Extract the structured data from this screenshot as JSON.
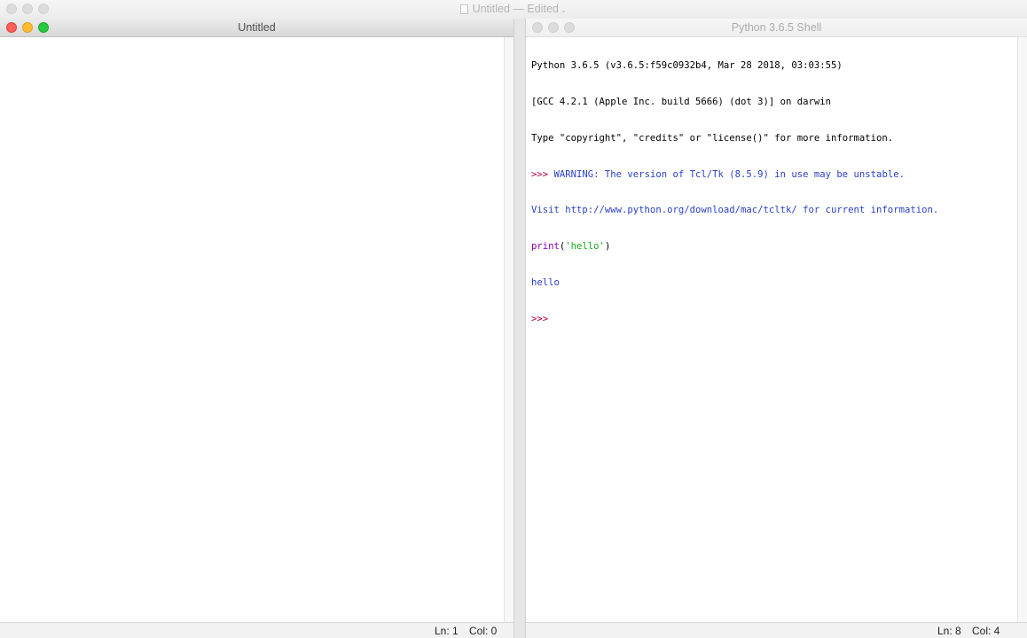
{
  "background_window": {
    "title": "Untitled",
    "edited_label": "— Edited",
    "chevron": "⌄"
  },
  "editor": {
    "title": "Untitled",
    "status": {
      "line": "Ln: 1",
      "col": "Col: 0"
    }
  },
  "shell": {
    "title": "Python 3.6.5 Shell",
    "lines": {
      "l1": "Python 3.6.5 (v3.6.5:f59c0932b4, Mar 28 2018, 03:03:55)",
      "l2": "[GCC 4.2.1 (Apple Inc. build 5666) (dot 3)] on darwin",
      "l3": "Type \"copyright\", \"credits\" or \"license()\" for more information.",
      "l4_prompt": ">>> ",
      "l4_text": "WARNING: The version of Tcl/Tk (8.5.9) in use may be unstable.",
      "l5": "Visit http://www.python.org/download/mac/tcltk/ for current information.",
      "l6_builtin": "print",
      "l6_open": "(",
      "l6_string": "'hello'",
      "l6_close": ")",
      "l7": "hello",
      "l8_prompt": ">>> "
    },
    "status": {
      "line": "Ln: 8",
      "col": "Col: 4"
    }
  },
  "colors": {
    "prompt": "#b0003a",
    "stdout": "#2a3fc7",
    "builtin": "#8a00a8",
    "string": "#1aa51a",
    "close_button": "#fc5f57",
    "minimize_button": "#fdbc2e",
    "zoom_button": "#28c840"
  }
}
